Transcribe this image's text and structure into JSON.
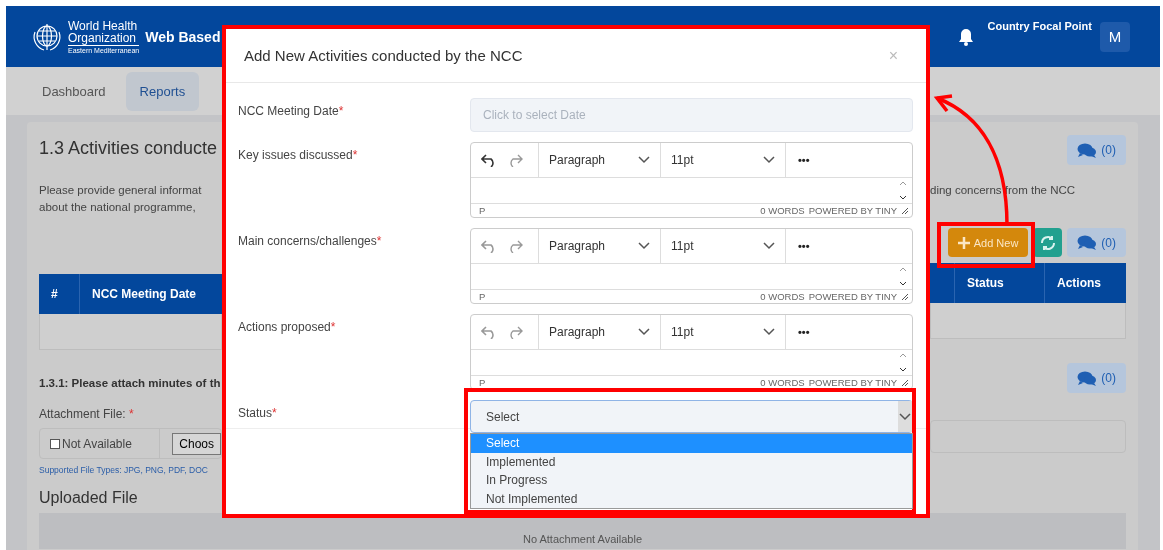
{
  "header": {
    "org_name_lines": [
      "World Health",
      "Organization"
    ],
    "org_region": "Eastern Mediterranean",
    "app_title": "Web Based",
    "user_role": "Country Focal Point",
    "avatar_initial": "M"
  },
  "nav": {
    "tabs": [
      {
        "label": "Dashboard",
        "selected": false
      },
      {
        "label": "Reports",
        "selected": true
      }
    ]
  },
  "section": {
    "title": "1.3 Activities conducte",
    "comments": "(0)",
    "description_left": [
      "Please provide general informat",
      "about the national programme,"
    ],
    "description_right": "ding concerns from the NCC",
    "add_button": "Add New",
    "list_comments": "(0)",
    "table": {
      "columns_left": [
        "#",
        "NCC Meeting Date"
      ],
      "columns_right": [
        "Status",
        "Actions"
      ]
    }
  },
  "attachment": {
    "heading": "1.3.1: Please attach minutes of th",
    "comments": "(0)",
    "label": "Attachment File:",
    "required_mark": "*",
    "not_available": {
      "label": "Not Available",
      "checked": false
    },
    "choose_button": "Choos",
    "supported_types": "Supported File Types: JPG, PNG, PDF, DOC"
  },
  "uploaded": {
    "title": "Uploaded File",
    "empty_text": "No Attachment Available"
  },
  "modal": {
    "title": "Add New Activities conducted by the NCC",
    "close": "×",
    "fields": [
      {
        "kind": "date",
        "label": "NCC Meeting Date",
        "required_mark": "*",
        "placeholder": "Click to select Date"
      },
      {
        "kind": "editor",
        "label": "Key issues discussed",
        "required_mark": "*",
        "undo_enabled": true,
        "block_format": "Paragraph",
        "font_size": "11pt",
        "more": "•••",
        "path": "P",
        "word_count": "0 WORDS",
        "powered_by": "POWERED BY TINY"
      },
      {
        "kind": "editor",
        "label": "Main concerns/challenges",
        "required_mark": "*",
        "undo_enabled": false,
        "block_format": "Paragraph",
        "font_size": "11pt",
        "more": "•••",
        "path": "P",
        "word_count": "0 WORDS",
        "powered_by": "POWERED BY TINY"
      },
      {
        "kind": "editor",
        "label": "Actions proposed",
        "required_mark": "*",
        "undo_enabled": false,
        "block_format": "Paragraph",
        "font_size": "11pt",
        "more": "•••",
        "path": "P",
        "word_count": "0 WORDS",
        "powered_by": "POWERED BY TINY"
      },
      {
        "kind": "select",
        "label": "Status",
        "required_mark": "*",
        "value": "Select",
        "expanded": true,
        "options": [
          {
            "label": "Select",
            "selected": true
          },
          {
            "label": "Implemented",
            "selected": false
          },
          {
            "label": "In Progress",
            "selected": false
          },
          {
            "label": "Not Implemented",
            "selected": false
          }
        ]
      }
    ]
  }
}
